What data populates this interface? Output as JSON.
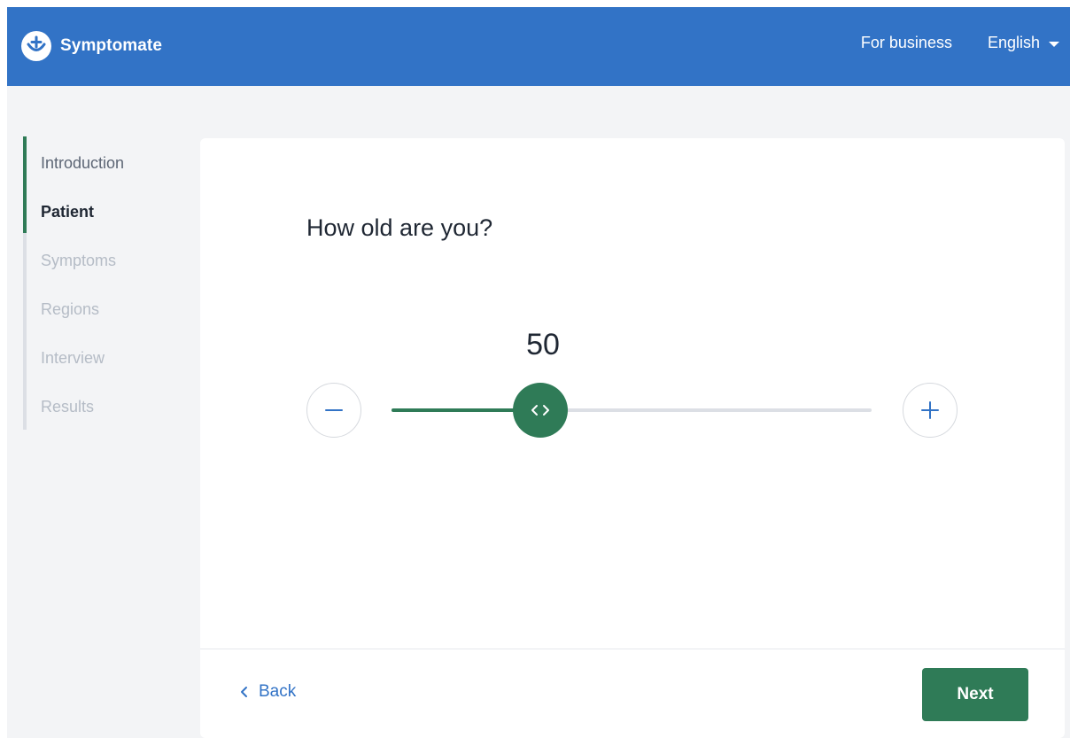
{
  "header": {
    "brand": "Symptomate",
    "for_business": "For business",
    "language": "English"
  },
  "sidebar": {
    "progress_fraction": 0.33,
    "items": [
      {
        "label": "Introduction",
        "state": "done"
      },
      {
        "label": "Patient",
        "state": "current"
      },
      {
        "label": "Symptoms",
        "state": "pending"
      },
      {
        "label": "Regions",
        "state": "pending"
      },
      {
        "label": "Interview",
        "state": "pending"
      },
      {
        "label": "Results",
        "state": "pending"
      }
    ]
  },
  "main": {
    "question": "How old are you?",
    "age": {
      "value": "50",
      "slider_fraction": 0.31
    },
    "back_label": "Back",
    "next_label": "Next"
  },
  "colors": {
    "header_blue": "#3273c6",
    "accent_green": "#2f7b57",
    "link_blue": "#3273c6"
  }
}
